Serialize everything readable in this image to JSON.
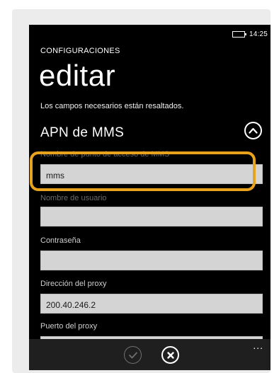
{
  "status_bar": {
    "time": "14:25",
    "battery_icon": "battery-icon"
  },
  "header": {
    "app_title": "CONFIGURACIONES",
    "page_title": "editar",
    "hint": "Los campos necesarios están resaltados."
  },
  "section": {
    "title": "APN de MMS",
    "collapse_icon": "chevron-up-icon"
  },
  "fields": [
    {
      "label": "Nombre de punto de acceso de MMS",
      "value": "mms"
    },
    {
      "label": "Nombre de usuario",
      "value": ""
    },
    {
      "label": "Contraseña",
      "value": ""
    },
    {
      "label": "Dirección del proxy",
      "value": "200.40.246.2"
    },
    {
      "label": "Puerto del proxy",
      "value": ""
    }
  ],
  "app_bar": {
    "accept_icon": "check-icon",
    "cancel_icon": "close-icon",
    "more": "..."
  },
  "colors": {
    "highlight": "#e8a21b",
    "background": "#000000",
    "field": "#d4d4d4"
  }
}
